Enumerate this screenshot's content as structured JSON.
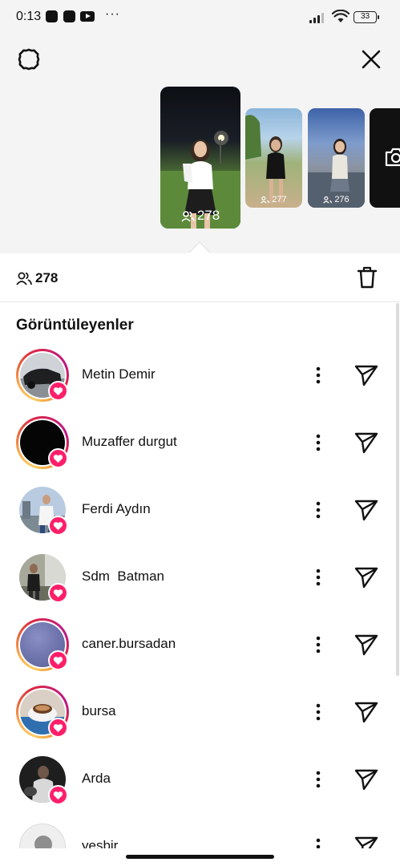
{
  "status_bar": {
    "time": "0:13",
    "dots": "···",
    "battery": "33"
  },
  "header": {
    "settings_icon": "gear-icon",
    "close_icon": "close-icon"
  },
  "stories": [
    {
      "count": "278",
      "selected": true
    },
    {
      "count": "277",
      "selected": false
    },
    {
      "count": "276",
      "selected": false
    }
  ],
  "camera_tile": {
    "icon": "camera-icon"
  },
  "summary": {
    "viewer_count": "278",
    "viewers_icon": "viewers-icon",
    "delete_icon": "trash-icon"
  },
  "section_title": "Görüntüleyenler",
  "viewers": [
    {
      "name": "Metin Demir",
      "ring": true,
      "liked": true
    },
    {
      "name": "Muzaffer durgut",
      "ring": true,
      "liked": true
    },
    {
      "name": "Ferdi Aydın",
      "ring": false,
      "liked": true
    },
    {
      "name": "Sdm  Batman",
      "ring": false,
      "liked": true
    },
    {
      "name": "caner.bursadan",
      "ring": true,
      "liked": true
    },
    {
      "name": "bursa",
      "ring": true,
      "liked": true
    },
    {
      "name": "Arda",
      "ring": false,
      "liked": true
    },
    {
      "name": "yesbir",
      "ring": false,
      "liked": false
    }
  ],
  "colors": {
    "heart_badge": "#ff1f69",
    "ring_start": "#fccc63",
    "ring_end": "#bc1888",
    "background_top": "#f4f4f4"
  }
}
